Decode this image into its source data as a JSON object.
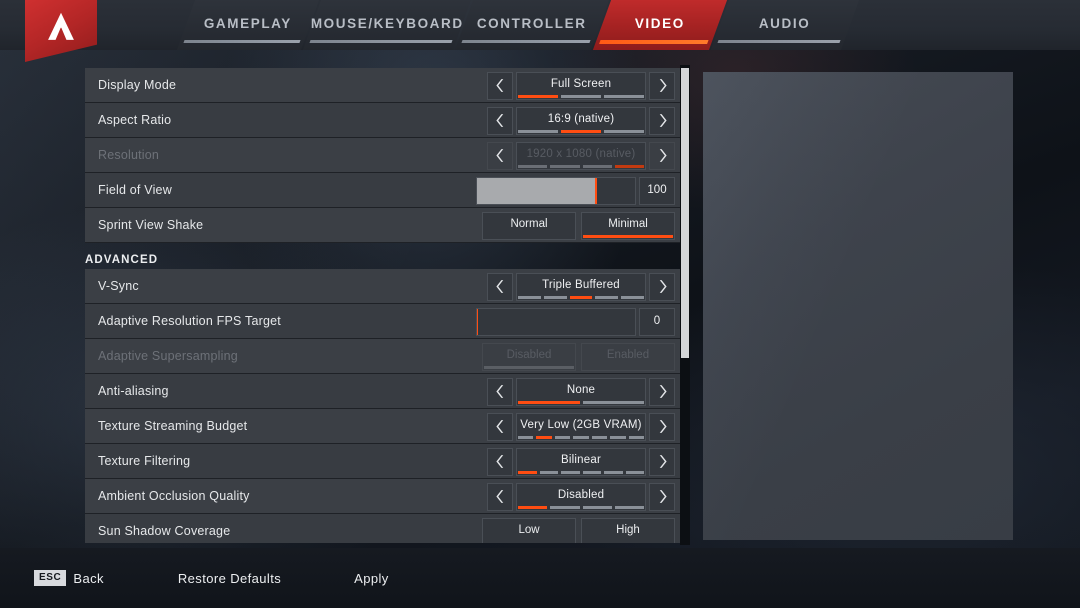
{
  "header": {
    "logo_icon": "apex-legends-logo",
    "tabs": [
      {
        "id": "gameplay",
        "label": "GAMEPLAY",
        "active": false
      },
      {
        "id": "mouse-keyboard",
        "label": "MOUSE/KEYBOARD",
        "active": false
      },
      {
        "id": "controller",
        "label": "CONTROLLER",
        "active": false
      },
      {
        "id": "video",
        "label": "VIDEO",
        "active": true
      },
      {
        "id": "audio",
        "label": "AUDIO",
        "active": false
      }
    ]
  },
  "settings": {
    "rows": [
      {
        "id": "display-mode",
        "type": "cycler",
        "label": "Display Mode",
        "value": "Full Screen",
        "segments": 3,
        "active_segment": 1,
        "disabled": false
      },
      {
        "id": "aspect-ratio",
        "type": "cycler",
        "label": "Aspect Ratio",
        "value": "16:9 (native)",
        "segments": 3,
        "active_segment": 2,
        "disabled": false
      },
      {
        "id": "resolution",
        "type": "cycler",
        "label": "Resolution",
        "value": "1920 x 1080 (native)",
        "segments": 4,
        "active_segment": 4,
        "disabled": true
      },
      {
        "id": "field-of-view",
        "type": "slider",
        "label": "Field of View",
        "value": "100",
        "fill_percent": 75,
        "disabled": false
      },
      {
        "id": "sprint-view-shake",
        "type": "toggle",
        "label": "Sprint View Shake",
        "options": [
          "Normal",
          "Minimal"
        ],
        "selected": "Minimal",
        "disabled": false
      },
      {
        "id": "advanced-heading",
        "type": "section",
        "label": "ADVANCED"
      },
      {
        "id": "v-sync",
        "type": "cycler",
        "label": "V-Sync",
        "value": "Triple Buffered",
        "segments": 5,
        "active_segment": 3,
        "disabled": false
      },
      {
        "id": "adaptive-resolution-fps-target",
        "type": "slider",
        "label": "Adaptive Resolution FPS Target",
        "value": "0",
        "fill_percent": 0,
        "disabled": false
      },
      {
        "id": "adaptive-supersampling",
        "type": "toggle",
        "label": "Adaptive Supersampling",
        "options": [
          "Disabled",
          "Enabled"
        ],
        "selected": "Disabled",
        "disabled": true
      },
      {
        "id": "anti-aliasing",
        "type": "cycler",
        "label": "Anti-aliasing",
        "value": "None",
        "segments": 2,
        "active_segment": 1,
        "disabled": false
      },
      {
        "id": "texture-streaming-budget",
        "type": "cycler",
        "label": "Texture Streaming Budget",
        "value": "Very Low (2GB VRAM)",
        "segments": 7,
        "active_segment": 2,
        "disabled": false
      },
      {
        "id": "texture-filtering",
        "type": "cycler",
        "label": "Texture Filtering",
        "value": "Bilinear",
        "segments": 6,
        "active_segment": 1,
        "disabled": false
      },
      {
        "id": "ambient-occlusion-quality",
        "type": "cycler",
        "label": "Ambient Occlusion Quality",
        "value": "Disabled",
        "segments": 4,
        "active_segment": 1,
        "disabled": false
      },
      {
        "id": "sun-shadow-coverage",
        "type": "toggle",
        "label": "Sun Shadow Coverage",
        "options": [
          "Low",
          "High"
        ],
        "selected": "",
        "disabled": false
      }
    ],
    "arrow_left_icon": "chevron-left-icon",
    "arrow_right_icon": "chevron-right-icon",
    "scrollbar_thumb_percent": 61
  },
  "footer": {
    "back_key": "ESC",
    "back_label": "Back",
    "restore_label": "Restore Defaults",
    "apply_label": "Apply"
  },
  "colors": {
    "accent_orange": "#ff4d12",
    "tab_active_red": "#b32626",
    "row_bg": "#3b3f45",
    "control_bg": "#33373d"
  }
}
